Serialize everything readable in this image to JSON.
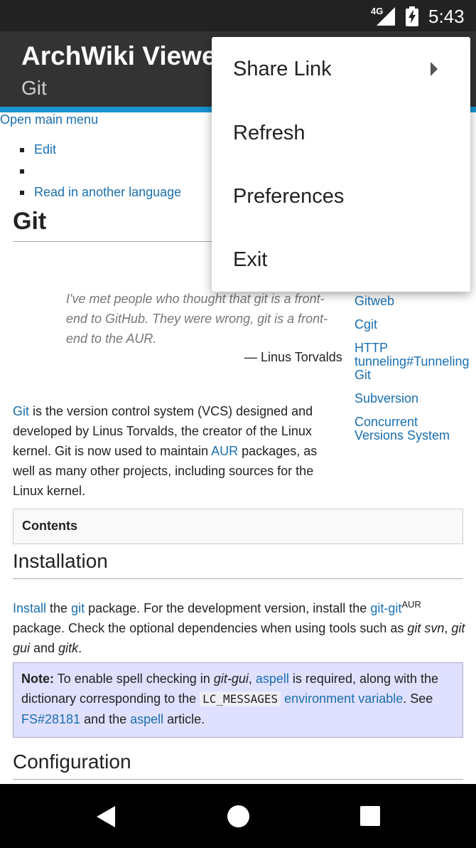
{
  "status_bar": {
    "network": "4G",
    "time": "5:43"
  },
  "app_bar": {
    "title": "ArchWiki Viewer",
    "subtitle": "Git"
  },
  "page": {
    "main_menu_link": "Open main menu",
    "actions": [
      "Edit",
      "",
      "Read in another language"
    ],
    "title": "Git",
    "quote": "I've met people who thought that git is a front-end to GitHub. They were wrong, git is a front-end to the AUR.",
    "quote_author": "— Linus Torvalds",
    "related": [
      "Gitweb",
      "Cgit",
      "HTTP tunneling#Tunneling Git",
      "Subversion",
      "Concurrent Versions System"
    ],
    "intro": {
      "git_link": "Git",
      "text1": " is the version control system (VCS) designed and developed by Linus Torvalds, the creator of the Linux kernel. Git is now used to maintain ",
      "aur_link": "AUR",
      "text2": " packages, as well as many other projects, including sources for the Linux kernel."
    },
    "contents_label": "Contents",
    "installation": {
      "heading": "Installation",
      "install_link": "Install",
      "t1": " the ",
      "git_link": "git",
      "t2": " package. For the development version, install the ",
      "gitgit_link": "git-git",
      "aur_sup": "AUR",
      "t3": " package. Check the optional dependencies when using tools such as ",
      "em1": "git svn",
      "t4": ", ",
      "em2": "git gui",
      "t5": " and ",
      "em3": "gitk",
      "t6": "."
    },
    "note": {
      "label": "Note:",
      "t1": " To enable spell checking in ",
      "em1": "git-gui",
      "t2": ", ",
      "aspell_link": "aspell",
      "t3": " is required, along with the dictionary corresponding to the ",
      "code": "LC_MESSAGES",
      "t4": " ",
      "envvar_link": "environment variable",
      "t5": ". See ",
      "fs_link": "FS#28181",
      "t6": " and the ",
      "aspell2_link": "aspell",
      "t7": " article."
    },
    "configuration_heading": "Configuration"
  },
  "menu": {
    "items": [
      {
        "label": "Share Link",
        "submenu": true
      },
      {
        "label": "Refresh"
      },
      {
        "label": "Preferences"
      },
      {
        "label": "Exit"
      }
    ]
  },
  "colors": {
    "accent": "#1793d1",
    "link": "#1a6fb0",
    "app_bar": "#333333",
    "note_bg": "#e0e0ff"
  },
  "icons": [
    "signal-icon",
    "battery-charging-icon",
    "submenu-arrow-icon",
    "nav-back-icon",
    "nav-home-icon",
    "nav-recents-icon"
  ]
}
